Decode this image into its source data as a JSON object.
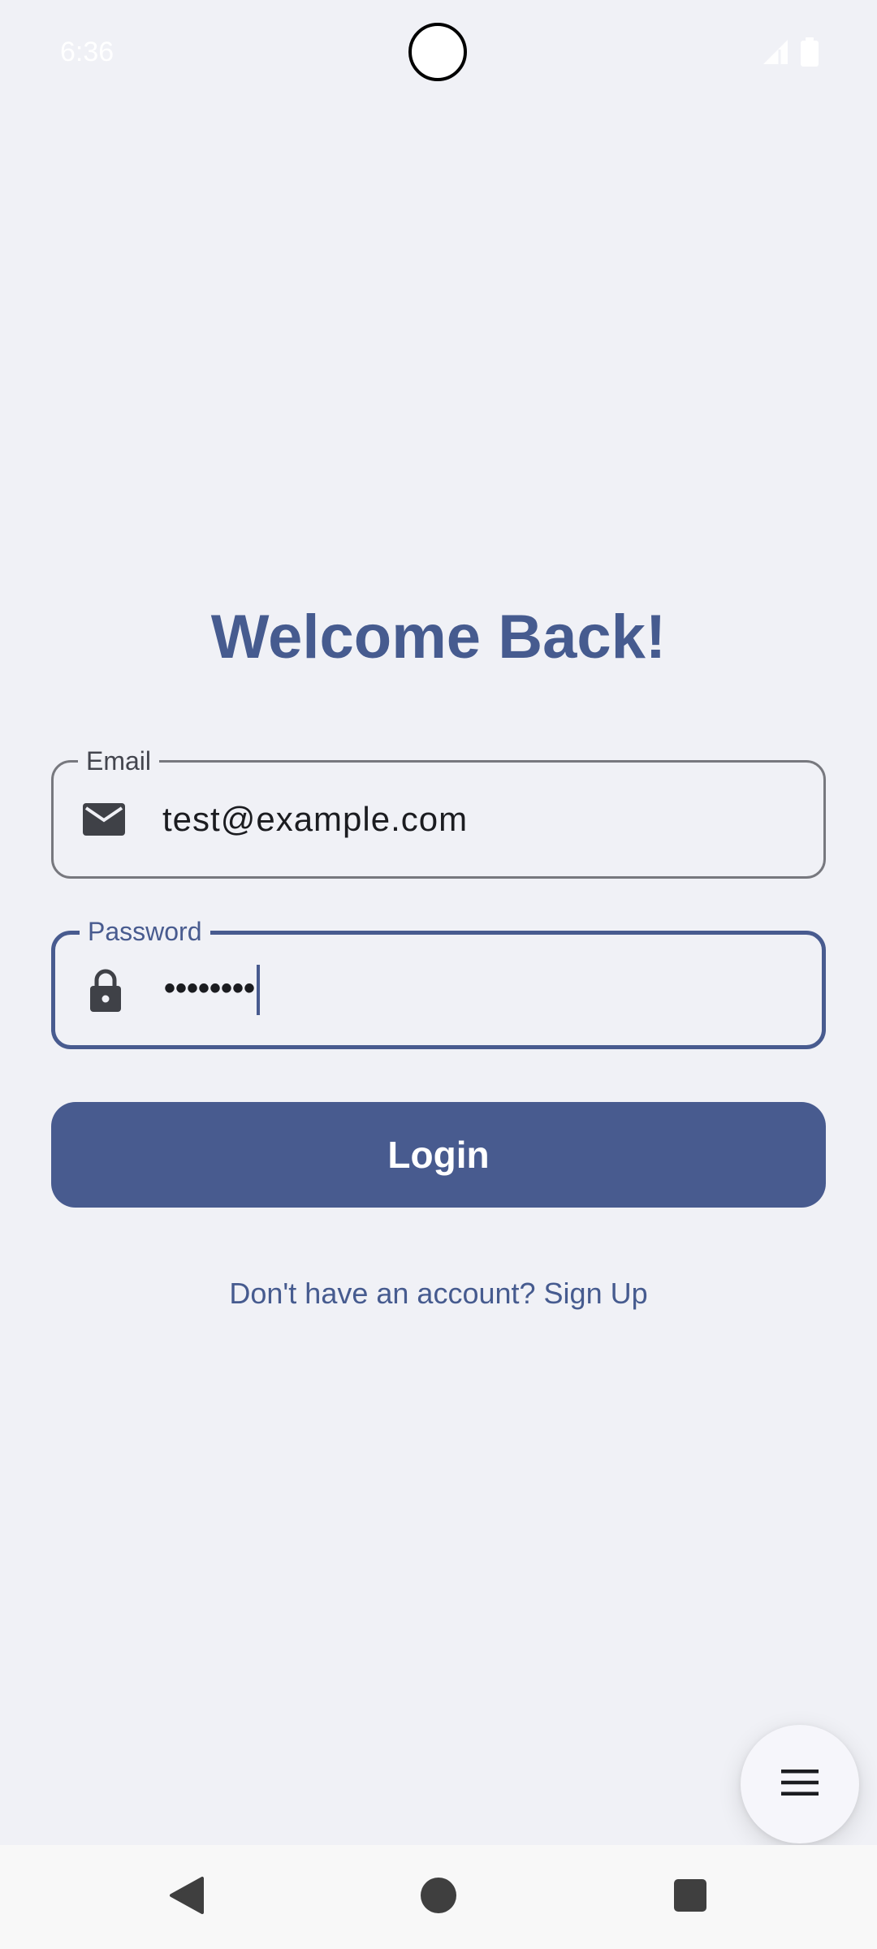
{
  "status_bar": {
    "time": "6:36",
    "icons": [
      "signal-icon",
      "battery-icon"
    ]
  },
  "login": {
    "title": "Welcome Back!",
    "email": {
      "label": "Email",
      "value": "test@example.com",
      "icon": "mail-icon"
    },
    "password": {
      "label": "Password",
      "value": "••••••••",
      "icon": "lock-icon"
    },
    "login_button": "Login",
    "signup_link": "Don't have an account? Sign Up"
  },
  "fab": {
    "icon": "menu-icon"
  },
  "nav_bar": {
    "items": [
      "back-icon",
      "home-icon",
      "recents-icon"
    ]
  },
  "colors": {
    "primary": "#485b8f",
    "background": "#f0f1f6",
    "outline": "#77787e"
  }
}
